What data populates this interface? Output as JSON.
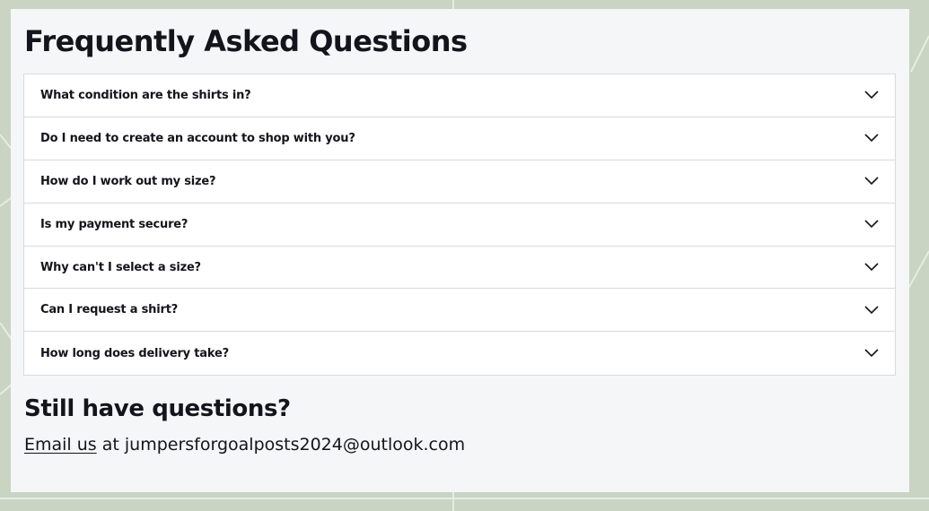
{
  "faq": {
    "title": "Frequently Asked Questions",
    "items": [
      {
        "question": "What condition are the shirts in?"
      },
      {
        "question": "Do I need to create an account to shop with you?"
      },
      {
        "question": "How do I work out my size?"
      },
      {
        "question": "Is my payment secure?"
      },
      {
        "question": "Why can't I select a size?"
      },
      {
        "question": "Can I request a shirt?"
      },
      {
        "question": "How long does delivery take?"
      }
    ],
    "expand_icon": "chevron-down-icon"
  },
  "contact": {
    "title": "Still have questions?",
    "link_label": "Email us",
    "connector": " at ",
    "email": "jumpersforgoalposts2024@outlook.com"
  },
  "colors": {
    "background": "#c9d4c3",
    "panel": "#f5f6f8",
    "text": "#14141c",
    "border": "#d9dadd"
  }
}
